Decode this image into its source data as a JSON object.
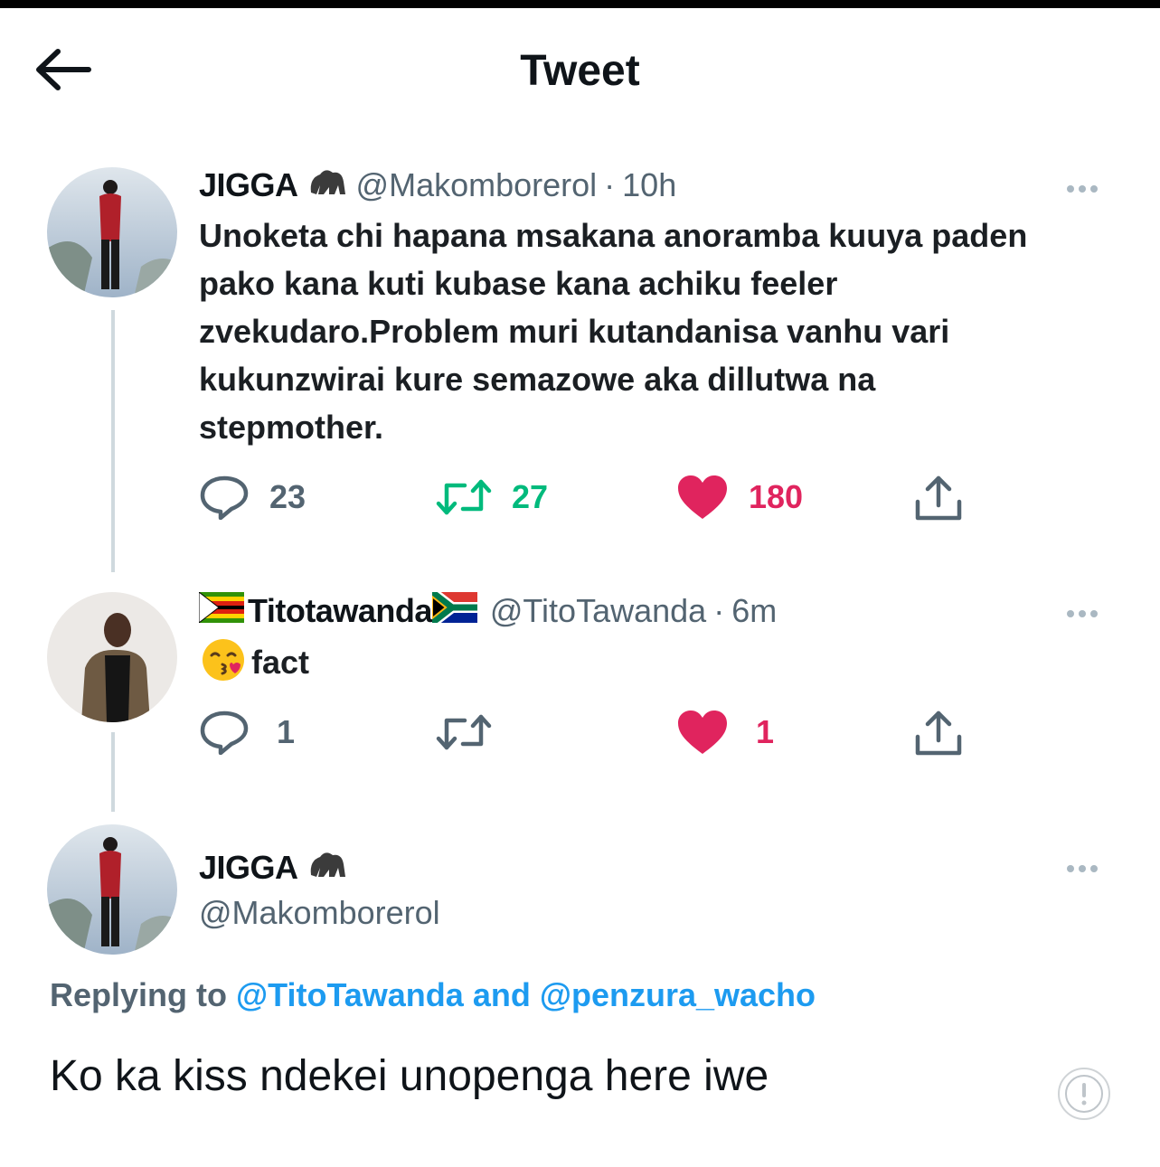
{
  "header": {
    "title": "Tweet"
  },
  "tweets": [
    {
      "name": "JIGGA",
      "handle": "@Makomborerol",
      "separator": "·",
      "time": "10h",
      "text": "Unoketa chi hapana msakana anoramba kuuya paden pako kana kuti kubase kana achiku feeler zvekudaro.Problem muri kutandanisa vanhu vari kukunzwirai kure semazowe aka dillutwa na stepmother.",
      "replies": "23",
      "retweets": "27",
      "likes": "180"
    },
    {
      "name": "Titotawanda",
      "handle": "@TitoTawanda",
      "separator": "·",
      "time": "6m",
      "text": "fact",
      "replies": "1",
      "retweets": "",
      "likes": "1"
    }
  ],
  "main_tweet": {
    "name": "JIGGA",
    "handle": "@Makomborerol",
    "replying_prefix": "Replying to",
    "reply_to_1": "@TitoTawanda",
    "reply_and": "and",
    "reply_to_2": "@penzura_wacho",
    "text": "Ko ka kiss ndekei unopenga here iwe"
  },
  "colors": {
    "text": "#0f1419",
    "secondary": "#536471",
    "link": "#1d9bf0",
    "retweet": "#00ba7c",
    "like": "#f91880"
  }
}
